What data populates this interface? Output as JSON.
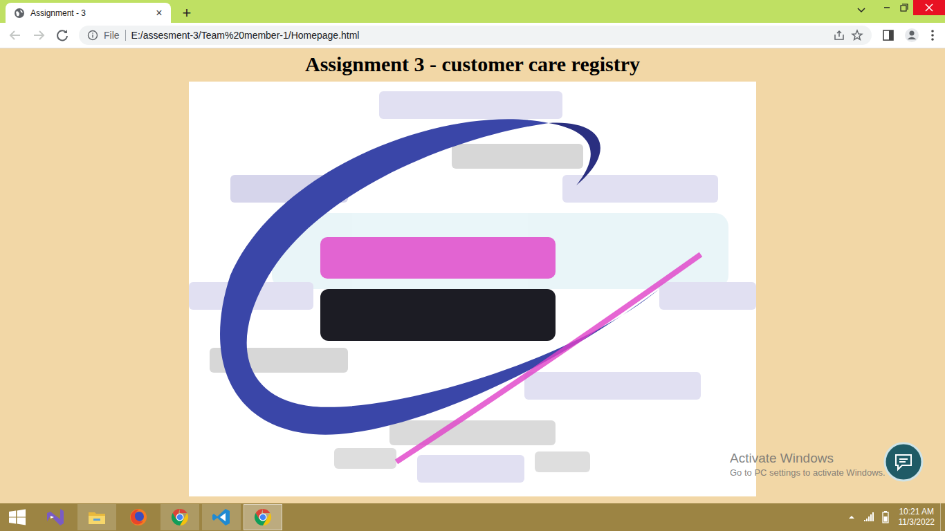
{
  "browser": {
    "tab": {
      "title": "Assignment - 3",
      "close": "×",
      "selected": true
    },
    "new_tab": "+",
    "address": {
      "scheme": "File",
      "url": "E:/assesment-3/Team%20member-1/Homepage.html"
    }
  },
  "page": {
    "heading": "Assignment 3 - customer care registry"
  },
  "watermark": {
    "title": "Activate Windows",
    "subtitle": "Go to PC settings to activate Windows."
  },
  "taskbar": {
    "apps": [
      {
        "kind": "visual-studio",
        "running": false,
        "selected": false
      },
      {
        "kind": "file-explorer",
        "running": true,
        "selected": false
      },
      {
        "kind": "firefox",
        "running": false,
        "selected": false
      },
      {
        "kind": "chrome",
        "running": true,
        "selected": false
      },
      {
        "kind": "vscode",
        "running": true,
        "selected": false
      },
      {
        "kind": "chrome",
        "running": true,
        "selected": true
      }
    ],
    "clock": {
      "time": "10:21 AM",
      "date": "11/3/2022"
    }
  }
}
